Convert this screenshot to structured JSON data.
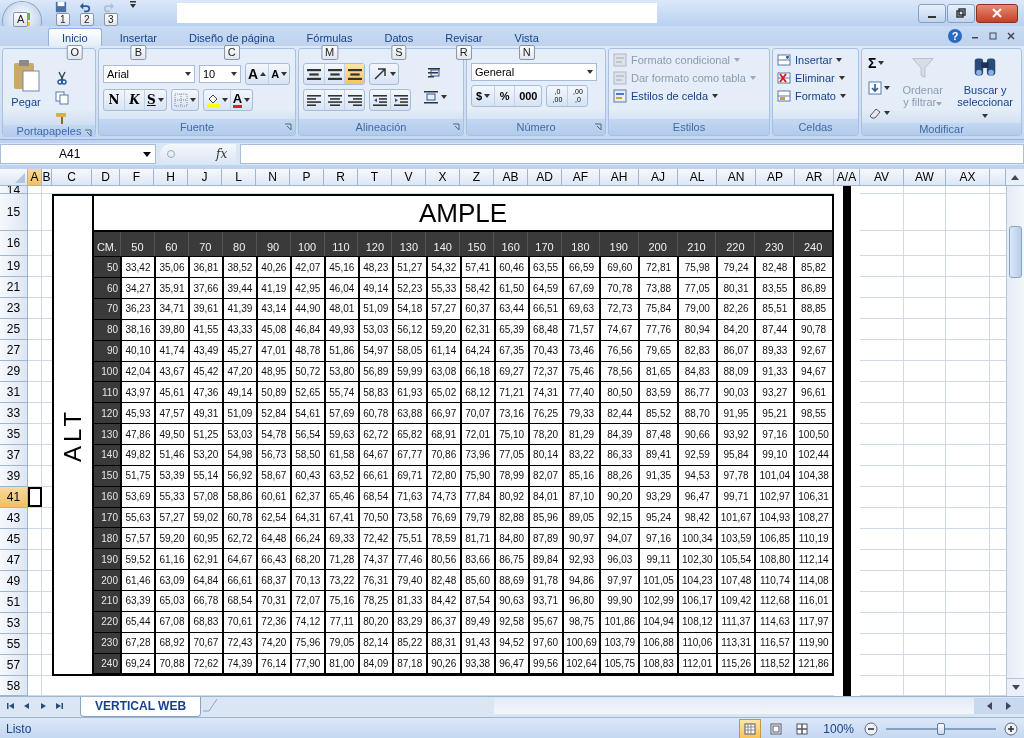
{
  "window": {
    "office_keytip": "A",
    "quick_access": [
      {
        "kind": "save",
        "keytip": "1",
        "disabled": false
      },
      {
        "kind": "undo",
        "keytip": "2",
        "disabled": false
      },
      {
        "kind": "redo",
        "keytip": "3",
        "disabled": true
      }
    ],
    "help": "?"
  },
  "tabs": [
    {
      "label": "Inicio",
      "keytip": "O",
      "selected": true
    },
    {
      "label": "Insertar",
      "keytip": "B",
      "selected": false
    },
    {
      "label": "Diseño de página",
      "keytip": "C",
      "selected": false
    },
    {
      "label": "Fórmulas",
      "keytip": "M",
      "selected": false
    },
    {
      "label": "Datos",
      "keytip": "S",
      "selected": false
    },
    {
      "label": "Revisar",
      "keytip": "R",
      "selected": false
    },
    {
      "label": "Vista",
      "keytip": "N",
      "selected": false
    }
  ],
  "clipboard": {
    "title": "Portapapeles",
    "paste": "Pegar"
  },
  "font": {
    "title": "Fuente",
    "family": "Arial",
    "size": "10",
    "grow": "A",
    "shrink": "A",
    "bold": "N",
    "italic": "K",
    "underline": "S",
    "font_color_letter": "A"
  },
  "alignment": {
    "title": "Alineación",
    "buttons": [
      {
        "kind": "top",
        "on": false
      },
      {
        "kind": "middle",
        "on": false
      },
      {
        "kind": "bottom",
        "on": true
      },
      {
        "kind": "orientation",
        "on": false
      },
      {
        "kind": "left",
        "on": false
      },
      {
        "kind": "center",
        "on": false
      },
      {
        "kind": "right",
        "on": false
      },
      {
        "kind": "outdent",
        "on": false
      },
      {
        "kind": "indent",
        "on": false
      },
      {
        "kind": "wrap",
        "on": false
      },
      {
        "kind": "merge",
        "on": false
      }
    ]
  },
  "number": {
    "title": "Número",
    "format": "General",
    "currency": "$",
    "percent": "%",
    "thousands": "000",
    "decimals": [
      {
        "top": ",0",
        "bottom": ",00"
      },
      {
        "top": ",00",
        "bottom": ",0"
      }
    ]
  },
  "styles": {
    "title": "Estilos",
    "items": [
      {
        "label": "Formato condicional",
        "disabled": true
      },
      {
        "label": "Dar formato como tabla",
        "disabled": true
      },
      {
        "label": "Estilos de celda",
        "disabled": false
      }
    ]
  },
  "cells": {
    "title": "Celdas",
    "items": [
      {
        "label": "Insertar",
        "kind": "insert"
      },
      {
        "label": "Eliminar",
        "kind": "delete"
      },
      {
        "label": "Formato",
        "kind": "format"
      }
    ]
  },
  "editing": {
    "title": "Modificar",
    "sum": "Σ",
    "sort": {
      "label": "Ordenar y filtrar",
      "disabled": true
    },
    "find": {
      "label": "Buscar y seleccionar",
      "disabled": false
    }
  },
  "formula_bar": {
    "name_box": "A41",
    "fx": "fx"
  },
  "sheet": {
    "columns": [
      {
        "label": "A",
        "selected": true
      },
      {
        "label": "B",
        "selected": false
      },
      {
        "label": "C",
        "selected": false
      },
      {
        "label": "D",
        "selected": false
      },
      {
        "label": "F",
        "selected": false
      },
      {
        "label": "H",
        "selected": false
      },
      {
        "label": "J",
        "selected": false
      },
      {
        "label": "L",
        "selected": false
      },
      {
        "label": "N",
        "selected": false
      },
      {
        "label": "P",
        "selected": false
      },
      {
        "label": "R",
        "selected": false
      },
      {
        "label": "T",
        "selected": false
      },
      {
        "label": "V",
        "selected": false
      },
      {
        "label": "X",
        "selected": false
      },
      {
        "label": "Z",
        "selected": false
      },
      {
        "label": "AB",
        "selected": false
      },
      {
        "label": "AD",
        "selected": false
      },
      {
        "label": "AF",
        "selected": false
      },
      {
        "label": "AH",
        "selected": false
      },
      {
        "label": "AJ",
        "selected": false
      },
      {
        "label": "AL",
        "selected": false
      },
      {
        "label": "AN",
        "selected": false
      },
      {
        "label": "AP",
        "selected": false
      },
      {
        "label": "AR",
        "selected": false
      },
      {
        "label": "A/A",
        "selected": false
      },
      {
        "label": "AV",
        "selected": false
      },
      {
        "label": "AW",
        "selected": false
      },
      {
        "label": "AX",
        "selected": false
      }
    ],
    "rows": [
      {
        "label": "14",
        "selected": false
      },
      {
        "label": "15",
        "selected": false
      },
      {
        "label": "16",
        "selected": false
      },
      {
        "label": "19",
        "selected": false
      },
      {
        "label": "21",
        "selected": false
      },
      {
        "label": "23",
        "selected": false
      },
      {
        "label": "25",
        "selected": false
      },
      {
        "label": "27",
        "selected": false
      },
      {
        "label": "29",
        "selected": false
      },
      {
        "label": "31",
        "selected": false
      },
      {
        "label": "33",
        "selected": false
      },
      {
        "label": "35",
        "selected": false
      },
      {
        "label": "37",
        "selected": false
      },
      {
        "label": "39",
        "selected": false
      },
      {
        "label": "41",
        "selected": true
      },
      {
        "label": "43",
        "selected": false
      },
      {
        "label": "45",
        "selected": false
      },
      {
        "label": "47",
        "selected": false
      },
      {
        "label": "49",
        "selected": false
      },
      {
        "label": "51",
        "selected": false
      },
      {
        "label": "53",
        "selected": false
      },
      {
        "label": "55",
        "selected": false
      },
      {
        "label": "57",
        "selected": false
      },
      {
        "label": "58",
        "selected": false
      }
    ]
  },
  "table": {
    "title": "AMPLE",
    "side_label": "ALT",
    "corner": "CM.",
    "widths": [
      "50",
      "60",
      "70",
      "80",
      "90",
      "100",
      "110",
      "120",
      "130",
      "140",
      "150",
      "160",
      "170",
      "180",
      "190",
      "200",
      "210",
      "220",
      "230",
      "240"
    ],
    "rows": [
      {
        "label": "50",
        "values": [
          "33,42",
          "35,06",
          "36,81",
          "38,52",
          "40,26",
          "42,07",
          "45,16",
          "48,23",
          "51,27",
          "54,32",
          "57,41",
          "60,46",
          "63,55",
          "66,59",
          "69,60",
          "72,81",
          "75,98",
          "79,24",
          "82,48",
          "85,82"
        ]
      },
      {
        "label": "60",
        "values": [
          "34,27",
          "35,91",
          "37,66",
          "39,44",
          "41,19",
          "42,95",
          "46,04",
          "49,14",
          "52,23",
          "55,33",
          "58,42",
          "61,50",
          "64,59",
          "67,69",
          "70,78",
          "73,88",
          "77,05",
          "80,31",
          "83,55",
          "86,89"
        ]
      },
      {
        "label": "70",
        "values": [
          "36,23",
          "34,71",
          "39,61",
          "41,39",
          "43,14",
          "44,90",
          "48,01",
          "51,09",
          "54,18",
          "57,27",
          "60,37",
          "63,44",
          "66,51",
          "69,63",
          "72,73",
          "75,84",
          "79,00",
          "82,26",
          "85,51",
          "88,85"
        ]
      },
      {
        "label": "80",
        "values": [
          "38,16",
          "39,80",
          "41,55",
          "43,33",
          "45,08",
          "46,84",
          "49,93",
          "53,03",
          "56,12",
          "59,20",
          "62,31",
          "65,39",
          "68,48",
          "71,57",
          "74,67",
          "77,76",
          "80,94",
          "84,20",
          "87,44",
          "90,78"
        ]
      },
      {
        "label": "90",
        "values": [
          "40,10",
          "41,74",
          "43,49",
          "45,27",
          "47,01",
          "48,78",
          "51,86",
          "54,97",
          "58,05",
          "61,14",
          "64,24",
          "67,35",
          "70,43",
          "73,46",
          "76,56",
          "79,65",
          "82,83",
          "86,07",
          "89,33",
          "92,67"
        ]
      },
      {
        "label": "100",
        "values": [
          "42,04",
          "43,67",
          "45,42",
          "47,20",
          "48,95",
          "50,72",
          "53,80",
          "56,89",
          "59,99",
          "63,08",
          "66,18",
          "69,27",
          "72,37",
          "75,46",
          "78,56",
          "81,65",
          "84,83",
          "88,09",
          "91,33",
          "94,67"
        ]
      },
      {
        "label": "110",
        "values": [
          "43,97",
          "45,61",
          "47,36",
          "49,14",
          "50,89",
          "52,65",
          "55,74",
          "58,83",
          "61,93",
          "65,02",
          "68,12",
          "71,21",
          "74,31",
          "77,40",
          "80,50",
          "83,59",
          "86,77",
          "90,03",
          "93,27",
          "96,61"
        ]
      },
      {
        "label": "120",
        "values": [
          "45,93",
          "47,57",
          "49,31",
          "51,09",
          "52,84",
          "54,61",
          "57,69",
          "60,78",
          "63,88",
          "66,97",
          "70,07",
          "73,16",
          "76,25",
          "79,33",
          "82,44",
          "85,52",
          "88,70",
          "91,95",
          "95,21",
          "98,55"
        ]
      },
      {
        "label": "130",
        "values": [
          "47,86",
          "49,50",
          "51,25",
          "53,03",
          "54,78",
          "56,54",
          "59,63",
          "62,72",
          "65,82",
          "68,91",
          "72,01",
          "75,10",
          "78,20",
          "81,29",
          "84,39",
          "87,48",
          "90,66",
          "93,92",
          "97,16",
          "100,50"
        ]
      },
      {
        "label": "140",
        "values": [
          "49,82",
          "51,46",
          "53,20",
          "54,98",
          "56,73",
          "58,50",
          "61,58",
          "64,67",
          "67,77",
          "70,86",
          "73,96",
          "77,05",
          "80,14",
          "83,22",
          "86,33",
          "89,41",
          "92,59",
          "95,84",
          "99,10",
          "102,44"
        ]
      },
      {
        "label": "150",
        "values": [
          "51,75",
          "53,39",
          "55,14",
          "56,92",
          "58,67",
          "60,43",
          "63,52",
          "66,61",
          "69,71",
          "72,80",
          "75,90",
          "78,99",
          "82,07",
          "85,16",
          "88,26",
          "91,35",
          "94,53",
          "97,78",
          "101,04",
          "104,38"
        ]
      },
      {
        "label": "160",
        "values": [
          "53,69",
          "55,33",
          "57,08",
          "58,86",
          "60,61",
          "62,37",
          "65,46",
          "68,54",
          "71,63",
          "74,73",
          "77,84",
          "80,92",
          "84,01",
          "87,10",
          "90,20",
          "93,29",
          "96,47",
          "99,71",
          "102,97",
          "106,31"
        ]
      },
      {
        "label": "170",
        "values": [
          "55,63",
          "57,27",
          "59,02",
          "60,78",
          "62,54",
          "64,31",
          "67,41",
          "70,50",
          "73,58",
          "76,69",
          "79,79",
          "82,88",
          "85,96",
          "89,05",
          "92,15",
          "95,24",
          "98,42",
          "101,67",
          "104,93",
          "108,27"
        ]
      },
      {
        "label": "180",
        "values": [
          "57,57",
          "59,20",
          "60,95",
          "62,72",
          "64,48",
          "66,24",
          "69,33",
          "72,42",
          "75,51",
          "78,59",
          "81,71",
          "84,80",
          "87,89",
          "90,97",
          "94,07",
          "97,16",
          "100,34",
          "103,59",
          "106,85",
          "110,19"
        ]
      },
      {
        "label": "190",
        "values": [
          "59,52",
          "61,16",
          "62,91",
          "64,67",
          "66,43",
          "68,20",
          "71,28",
          "74,37",
          "77,46",
          "80,56",
          "83,66",
          "86,75",
          "89,84",
          "92,93",
          "96,03",
          "99,11",
          "102,30",
          "105,54",
          "108,80",
          "112,14"
        ]
      },
      {
        "label": "200",
        "values": [
          "61,46",
          "63,09",
          "64,84",
          "66,61",
          "68,37",
          "70,13",
          "73,22",
          "76,31",
          "79,40",
          "82,48",
          "85,60",
          "88,69",
          "91,78",
          "94,86",
          "97,97",
          "101,05",
          "104,23",
          "107,48",
          "110,74",
          "114,08"
        ]
      },
      {
        "label": "210",
        "values": [
          "63,39",
          "65,03",
          "66,78",
          "68,54",
          "70,31",
          "72,07",
          "75,16",
          "78,25",
          "81,33",
          "84,42",
          "87,54",
          "90,63",
          "93,71",
          "96,80",
          "99,90",
          "102,99",
          "106,17",
          "109,42",
          "112,68",
          "116,01"
        ]
      },
      {
        "label": "220",
        "values": [
          "65,44",
          "67,08",
          "68,83",
          "70,61",
          "72,36",
          "74,12",
          "77,11",
          "80,20",
          "83,29",
          "86,37",
          "89,49",
          "92,58",
          "95,67",
          "98,75",
          "101,86",
          "104,94",
          "108,12",
          "111,37",
          "114,63",
          "117,97"
        ]
      },
      {
        "label": "230",
        "values": [
          "67,28",
          "68,92",
          "70,67",
          "72,43",
          "74,20",
          "75,96",
          "79,05",
          "82,14",
          "85,22",
          "88,31",
          "91,43",
          "94,52",
          "97,60",
          "100,69",
          "103,79",
          "106,88",
          "110,06",
          "113,31",
          "116,57",
          "119,90"
        ]
      },
      {
        "label": "240",
        "values": [
          "69,24",
          "70,88",
          "72,62",
          "74,39",
          "76,14",
          "77,90",
          "81,00",
          "84,09",
          "87,18",
          "90,26",
          "93,38",
          "96,47",
          "99,56",
          "102,64",
          "105,75",
          "108,83",
          "112,01",
          "115,26",
          "118,52",
          "121,86"
        ]
      }
    ]
  },
  "sheet_tabs": [
    {
      "label": "VERTICAL WEB",
      "selected": true
    }
  ],
  "status_bar": {
    "status": "Listo",
    "views": [
      {
        "kind": "normal",
        "selected": true
      },
      {
        "kind": "layout",
        "selected": false
      },
      {
        "kind": "break",
        "selected": false
      }
    ],
    "zoom": "100%",
    "zoom_slider": {
      "level": 0.5
    }
  }
}
